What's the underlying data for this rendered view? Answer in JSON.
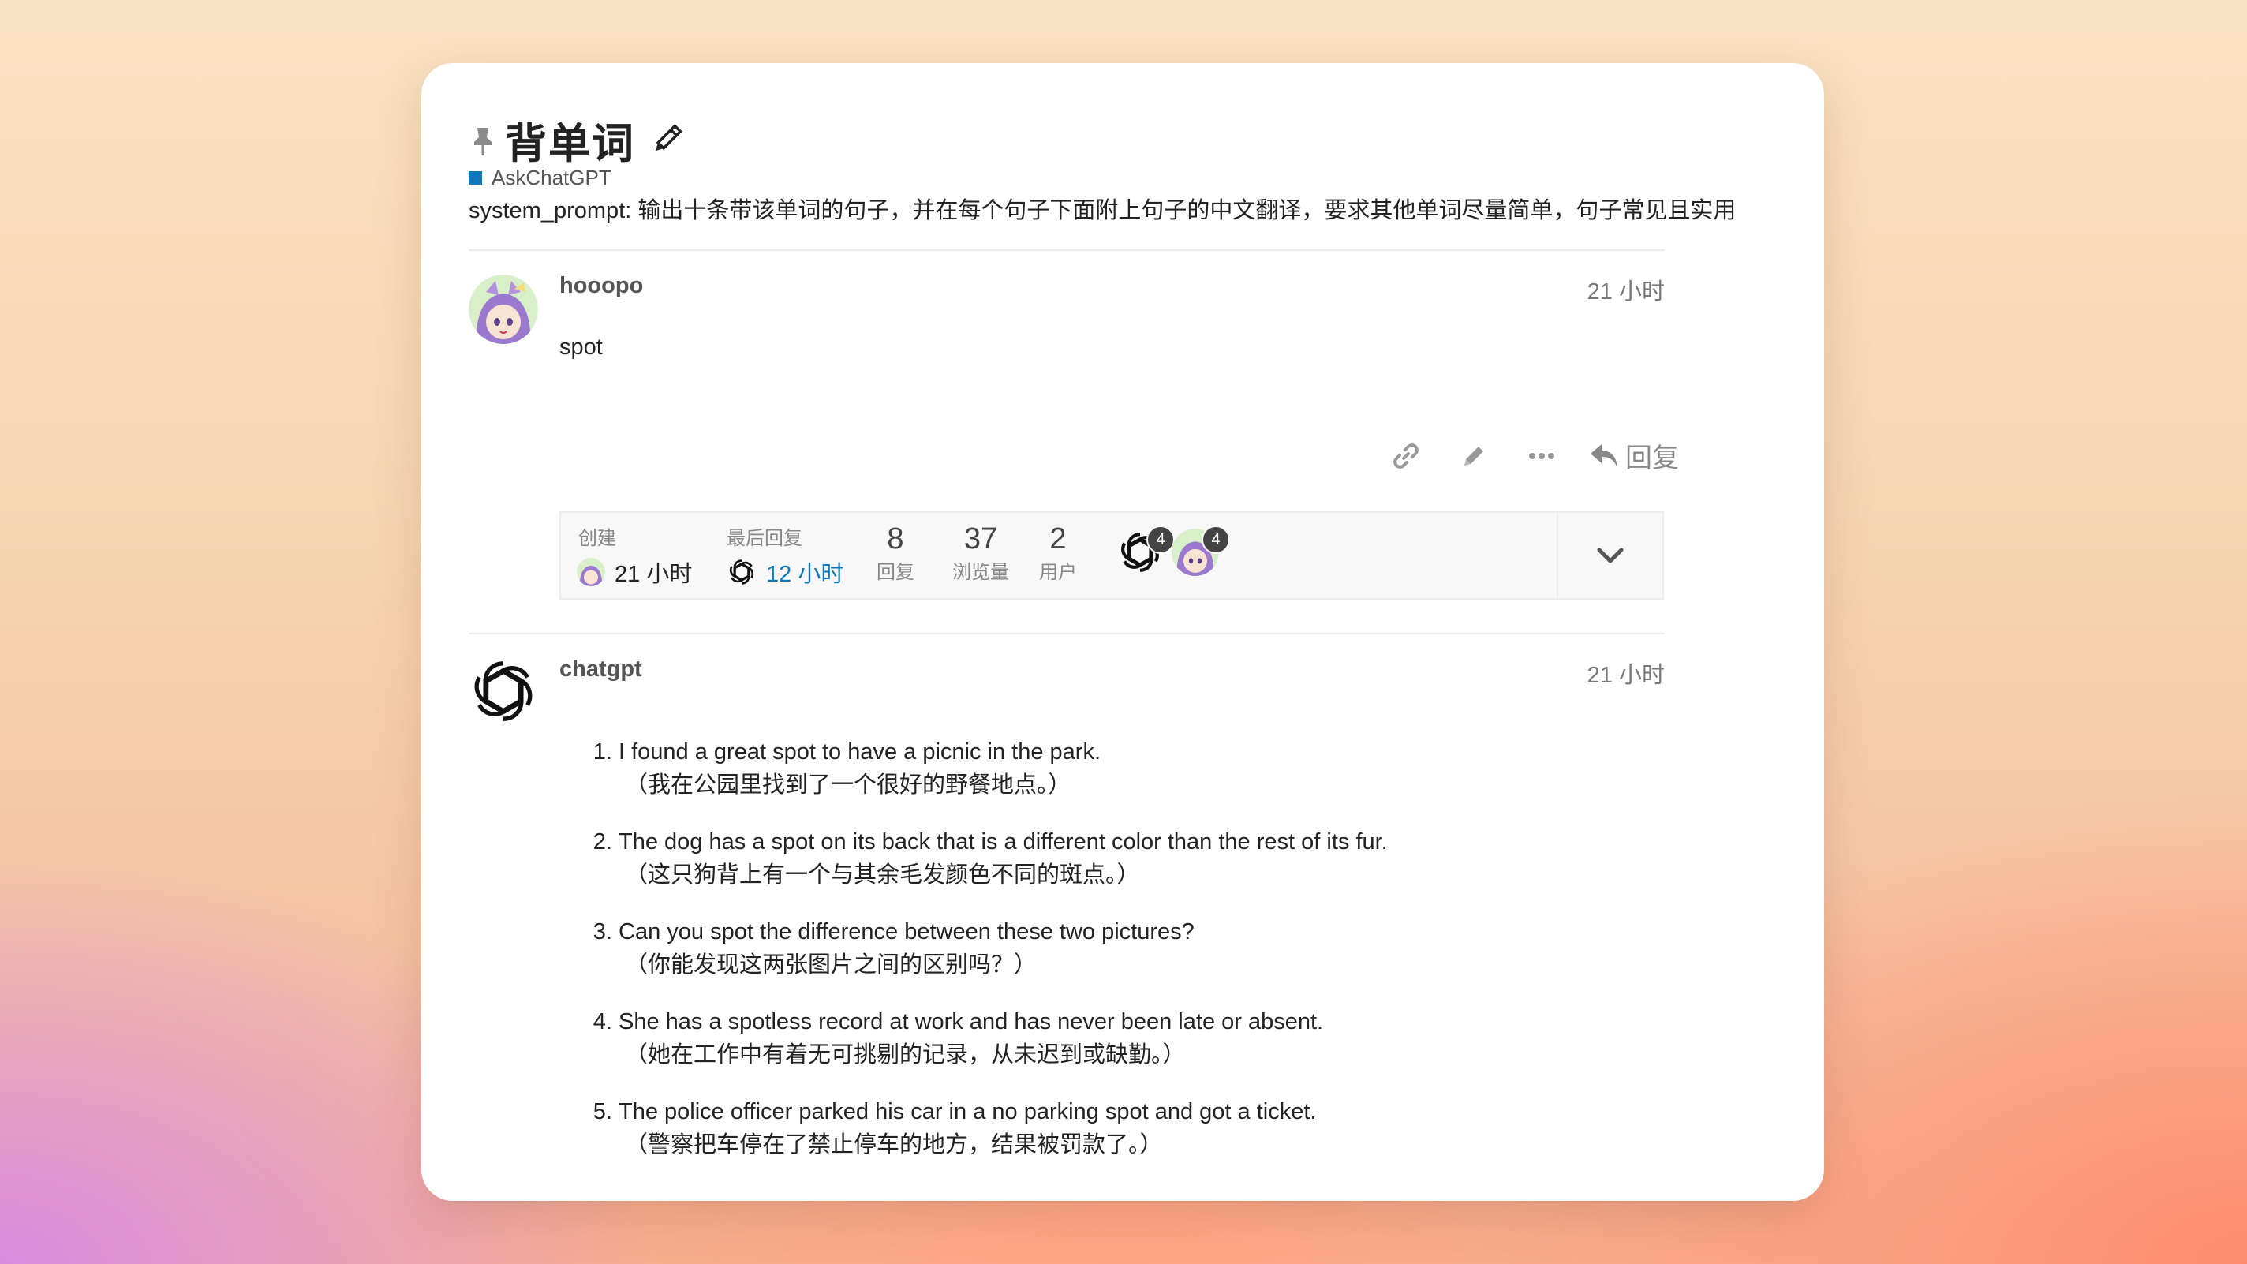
{
  "topic": {
    "title": "背单词",
    "category": "AskChatGPT",
    "system_prompt": "system_prompt: 输出十条带该单词的句子，并在每个句子下面附上句子的中文翻译，要求其他单词尽量简单，句子常见且实用"
  },
  "post1": {
    "username": "hooopo",
    "time": "21 小时",
    "body": "spot",
    "reply_label": "回复"
  },
  "topic_map": {
    "created_label": "创建",
    "created_value": "21 小时",
    "last_reply_label": "最后回复",
    "last_reply_value": "12 小时",
    "replies_count": "8",
    "replies_label": "回复",
    "views_count": "37",
    "views_label": "浏览量",
    "users_count": "2",
    "users_label": "用户",
    "participant_badge_1": "4",
    "participant_badge_2": "4"
  },
  "post2": {
    "username": "chatgpt",
    "time": "21 小时",
    "sentences": [
      {
        "en": "I found a great spot to have a picnic in the park.",
        "zh": "（我在公园里找到了一个很好的野餐地点。）"
      },
      {
        "en": "The dog has a spot on its back that is a different color than the rest of its fur.",
        "zh": "（这只狗背上有一个与其余毛发颜色不同的斑点。）"
      },
      {
        "en": "Can you spot the difference between these two pictures?",
        "zh": "（你能发现这两张图片之间的区别吗？）"
      },
      {
        "en": "She has a spotless record at work and has never been late or absent.",
        "zh": "（她在工作中有着无可挑剔的记录，从未迟到或缺勤。）"
      },
      {
        "en": "The police officer parked his car in a no parking spot and got a ticket.",
        "zh": "（警察把车停在了禁止停车的地方，结果被罚款了。）"
      }
    ]
  },
  "colors": {
    "category_square": "#0e76bd",
    "link_blue": "#0e76bd",
    "badge": "#444444"
  }
}
